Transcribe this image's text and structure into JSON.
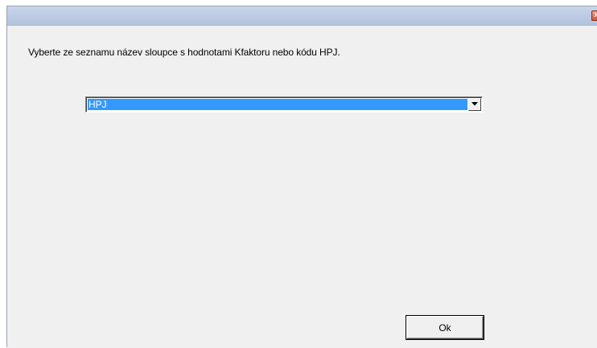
{
  "dialog": {
    "close_glyph": "✕",
    "instruction": "Vyberte ze seznamu název sloupce s hodnotami Kfaktoru nebo kódu HPJ.",
    "column_select": {
      "selected_value": "HPJ"
    },
    "ok_label": "Ok"
  },
  "colors": {
    "selection": "#3399ff",
    "titlebar": "#bccbe3",
    "close_button": "#c8553d",
    "dialog_background": "#f0f0f0"
  }
}
